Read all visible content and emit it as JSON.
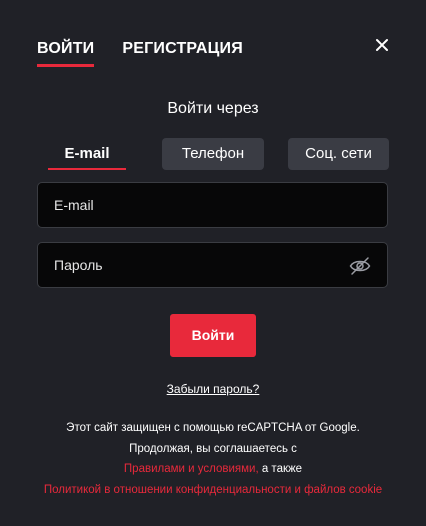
{
  "tabs": {
    "login": "ВОЙТИ",
    "register": "РЕГИСТРАЦИЯ"
  },
  "close_icon": "close-icon",
  "via_title": "Войти через",
  "methods": {
    "email": "E-mail",
    "phone": "Телефон",
    "social": "Соц. сети"
  },
  "fields": {
    "email_placeholder": "E-mail",
    "password_placeholder": "Пароль"
  },
  "eye_icon": "eye-slash-icon",
  "login_button": "Войти",
  "forgot_link": "Забыли пароль?",
  "legal": {
    "line1": "Этот сайт защищен с помощью reCAPTCHA от Google.",
    "line2": "Продолжая, вы соглашаетесь с",
    "terms_link": "Правилами и условиями,",
    "also": " а также",
    "privacy_link": "Политикой в отношении конфиденциальности и файлов cookie"
  },
  "colors": {
    "accent": "#e8293b",
    "background": "#202127",
    "field_bg": "#070708",
    "method_bg": "#3a3c44"
  }
}
